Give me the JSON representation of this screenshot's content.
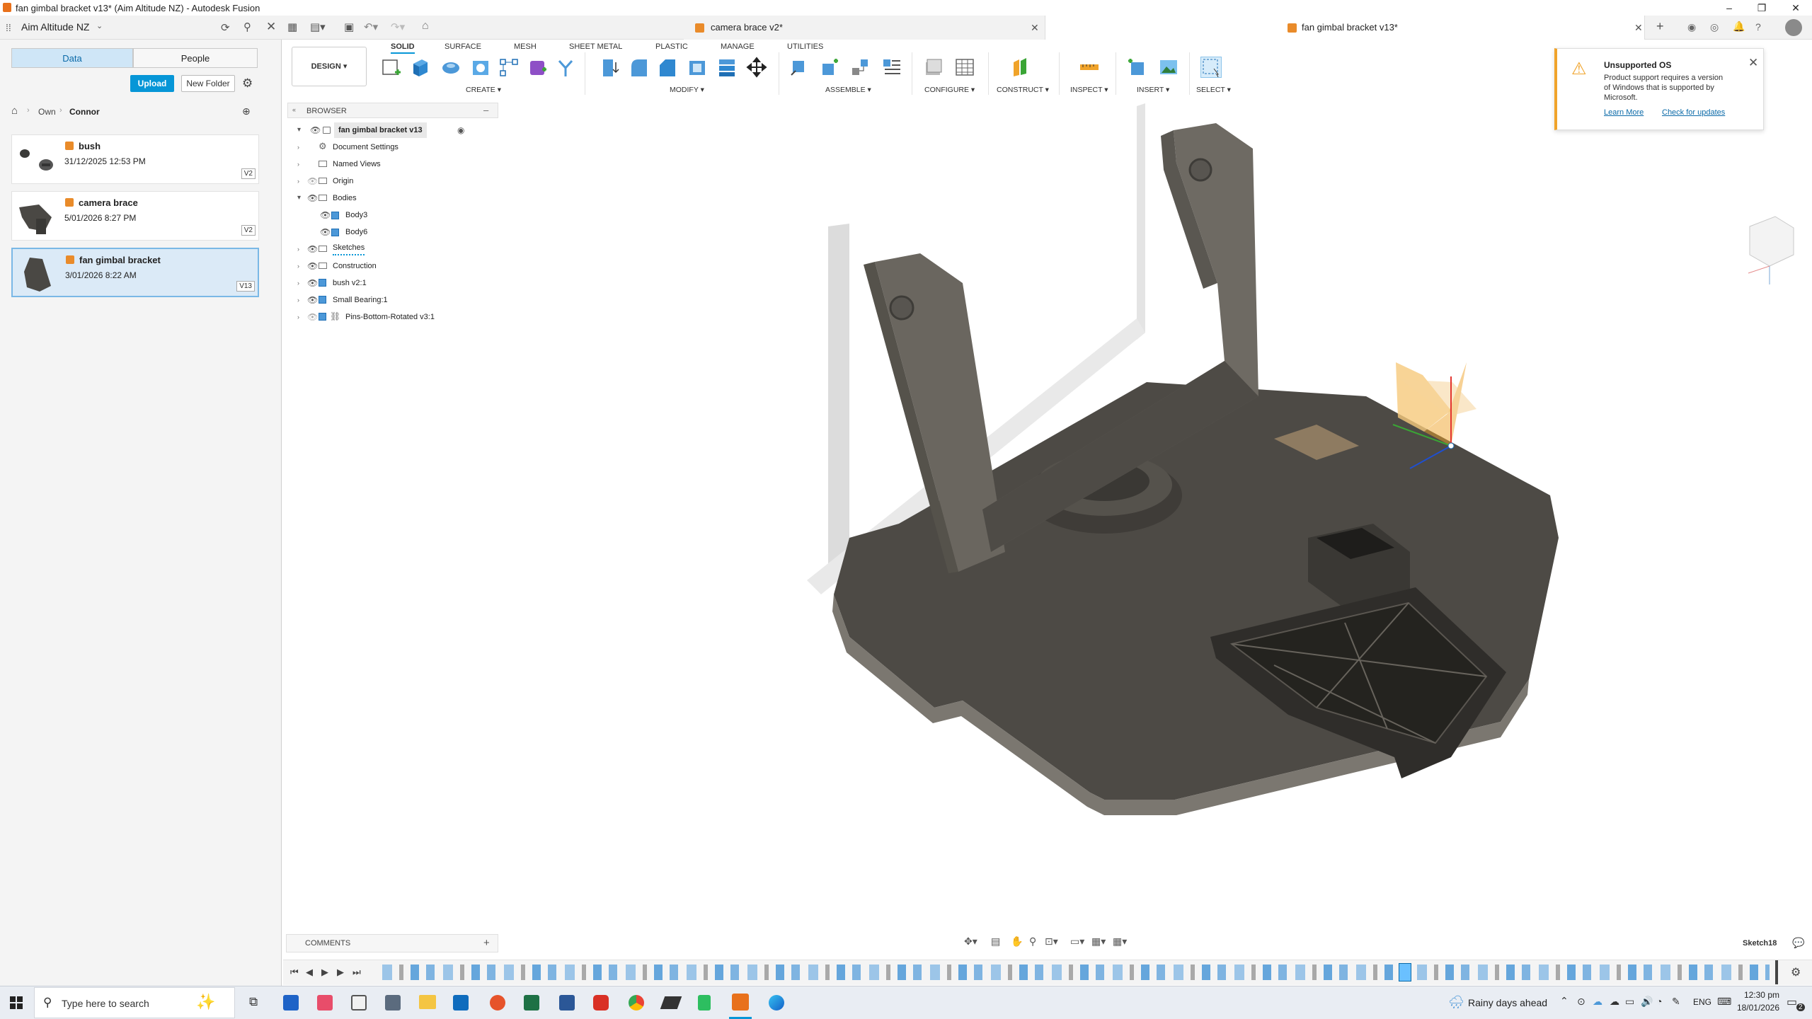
{
  "window": {
    "title": "fan gimbal bracket v13* (Aim Altitude NZ) - Autodesk Fusion",
    "minimize": "–",
    "maximize": "❐",
    "close": "✕"
  },
  "app": {
    "team": "Aim Altitude NZ",
    "tabs": [
      {
        "label": "camera brace v2*"
      },
      {
        "label": "fan gimbal bracket v13*"
      }
    ]
  },
  "data_panel": {
    "tabs": [
      "Data",
      "People"
    ],
    "upload_label": "Upload",
    "new_folder_label": "New Folder",
    "breadcrumb": [
      "Own",
      "Connor"
    ],
    "files": [
      {
        "name": "bush",
        "date": "31/12/2025 12:53 PM",
        "version": "V2"
      },
      {
        "name": "camera brace",
        "date": "5/01/2026 8:27 PM",
        "version": "V2"
      },
      {
        "name": "fan gimbal bracket",
        "date": "3/01/2026 8:22 AM",
        "version": "V13"
      }
    ]
  },
  "ribbon": {
    "workspace": "DESIGN",
    "tabs": [
      "SOLID",
      "SURFACE",
      "MESH",
      "SHEET METAL",
      "PLASTIC",
      "MANAGE",
      "UTILITIES"
    ],
    "groups": [
      "CREATE",
      "MODIFY",
      "ASSEMBLE",
      "CONFIGURE",
      "CONSTRUCT",
      "INSPECT",
      "INSERT",
      "SELECT"
    ]
  },
  "browser": {
    "title": "BROWSER",
    "root": "fan gimbal bracket v13",
    "items": [
      "Document Settings",
      "Named Views",
      "Origin",
      "Bodies",
      "Body3",
      "Body6",
      "Sketches",
      "Construction",
      "bush v2:1",
      "Small Bearing:1",
      "Pins-Bottom-Rotated v3:1"
    ]
  },
  "notification": {
    "title": "Unsupported OS",
    "body": "Product support requires a version of Windows that is supported by Microsoft.",
    "link1": "Learn More",
    "link2": "Check for updates"
  },
  "comments": {
    "label": "COMMENTS"
  },
  "status": {
    "sketch": "Sketch18"
  },
  "taskbar": {
    "search_placeholder": "Type here to search",
    "weather": "Rainy days ahead",
    "lang": "ENG",
    "time": "12:30 pm",
    "date": "18/01/2026",
    "notif_count": "2"
  },
  "colors": {
    "accent": "#0696d7",
    "warning": "#f0a32a",
    "fusion_orange": "#e98b2a",
    "model": "#4a4844"
  }
}
